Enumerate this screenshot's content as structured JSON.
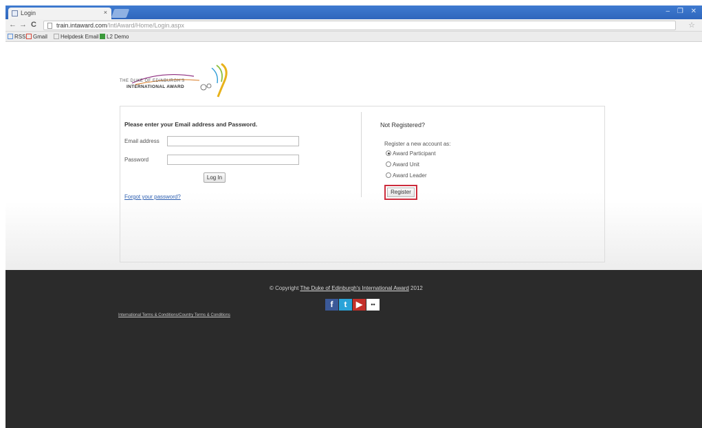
{
  "browser": {
    "tab_title": "Login",
    "tab_close": "×",
    "window_controls": "– ❐ ✕",
    "url_host": "train.intaward.com",
    "url_path": "/IntlAward/Home/Login.aspx",
    "back_icon": "←",
    "forward_icon": "→",
    "reload_icon": "C",
    "star_icon": "☆"
  },
  "bookmarks": [
    {
      "label": "RSS",
      "color": "#5a8fd8"
    },
    {
      "label": "Gmail",
      "color": "#d44638"
    },
    {
      "label": "Helpdesk Email",
      "color": "#d8d8d8"
    },
    {
      "label": "L2 Demo",
      "color": "#3c9a3c"
    }
  ],
  "logo": {
    "line1": "THE DUKE OF EDINBURGH'S",
    "line2": "INTERNATIONAL AWARD"
  },
  "login": {
    "heading": "Please enter your Email address and Password.",
    "email_label": "Email address",
    "email_value": "",
    "password_label": "Password",
    "password_value": "",
    "button": "Log In",
    "forgot": "Forgot your password?"
  },
  "register": {
    "heading": "Not Registered?",
    "prompt": "Register a new account as:",
    "options": [
      {
        "label": "Award Participant",
        "selected": true
      },
      {
        "label": "Award Unit",
        "selected": false
      },
      {
        "label": "Award Leader",
        "selected": false
      }
    ],
    "button": "Register",
    "highlight_color": "#cc2b3b"
  },
  "footer": {
    "copyright_prefix": "© Copyright",
    "copyright_link": "The Duke of Edinburgh's International Award",
    "copyright_year": "2012",
    "terms": "International Terms & Conditions/Country Terms & Conditions",
    "social": [
      {
        "name": "facebook-icon",
        "glyph": "f",
        "color": "#3b5998"
      },
      {
        "name": "twitter-icon",
        "glyph": "t",
        "color": "#2aa3d8"
      },
      {
        "name": "youtube-icon",
        "glyph": "▶",
        "color": "#c4302b"
      },
      {
        "name": "flickr-icon",
        "glyph": "••",
        "color": "#ffffff"
      }
    ]
  }
}
